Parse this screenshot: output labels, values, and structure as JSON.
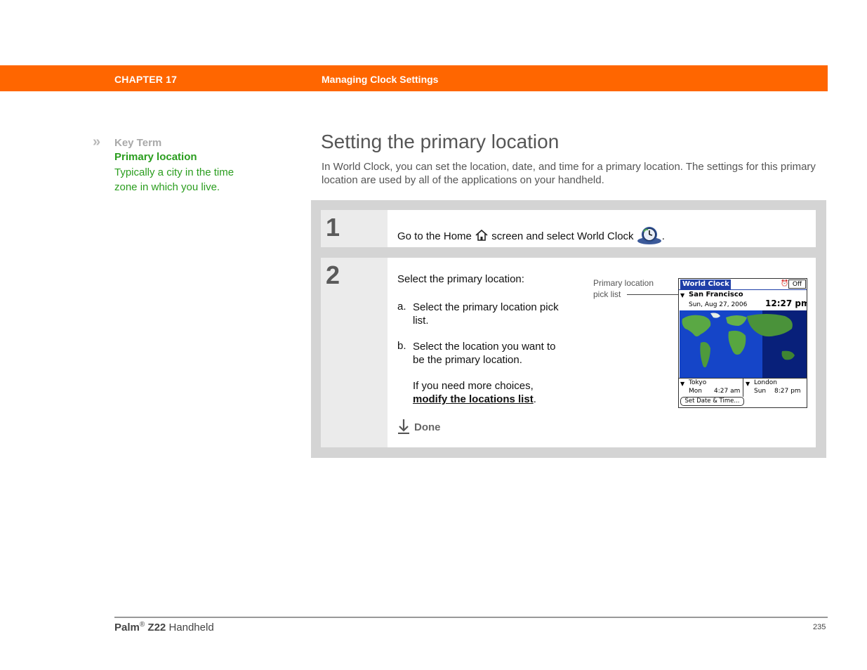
{
  "header": {
    "chapter": "CHAPTER 17",
    "title": "Managing Clock Settings",
    "band_color": "#ff6600"
  },
  "sidebar": {
    "chevron": "»",
    "key_term_label": "Key Term",
    "term": "Primary location",
    "definition": "Typically a city in the time zone in which you live.",
    "term_color": "#2a9d1e"
  },
  "main": {
    "title": "Setting the primary location",
    "intro": "In World Clock, you can set the location, date, and time for a primary location. The settings for this primary location are used by all of the applications on your handheld."
  },
  "steps": [
    {
      "number": "1",
      "text_before": "Go to the Home",
      "home_icon": "home-icon",
      "text_middle": "screen and select World Clock",
      "app_icon": "world-clock-icon",
      "text_after": "."
    },
    {
      "number": "2",
      "intro": "Select the primary location:",
      "substeps": [
        {
          "letter": "a.",
          "text": "Select the primary location pick list."
        },
        {
          "letter": "b.",
          "text": "Select the location you want to be the primary location."
        }
      ],
      "more_text": "If you need more choices,",
      "link_text": "modify the locations list",
      "link_after": ".",
      "done_label": "Done",
      "done_icon": "arrow-down-icon"
    }
  ],
  "callout": {
    "line1": "Primary location",
    "line2": "pick list"
  },
  "device": {
    "app_title": "World Clock",
    "alarm_toggle": "Off",
    "primary_city": "San Francisco",
    "date": "Sun, Aug 27, 2006",
    "time": "12:27 pm",
    "secondary": [
      {
        "city": "Tokyo",
        "day": "Mon",
        "time": "4:27 am"
      },
      {
        "city": "London",
        "day": "Sun",
        "time": "8:27 pm"
      }
    ],
    "button": "Set Date & Time..."
  },
  "footer": {
    "brand": "Palm",
    "reg": "®",
    "model": "Z22",
    "product": "Handheld",
    "page_number": "235"
  }
}
